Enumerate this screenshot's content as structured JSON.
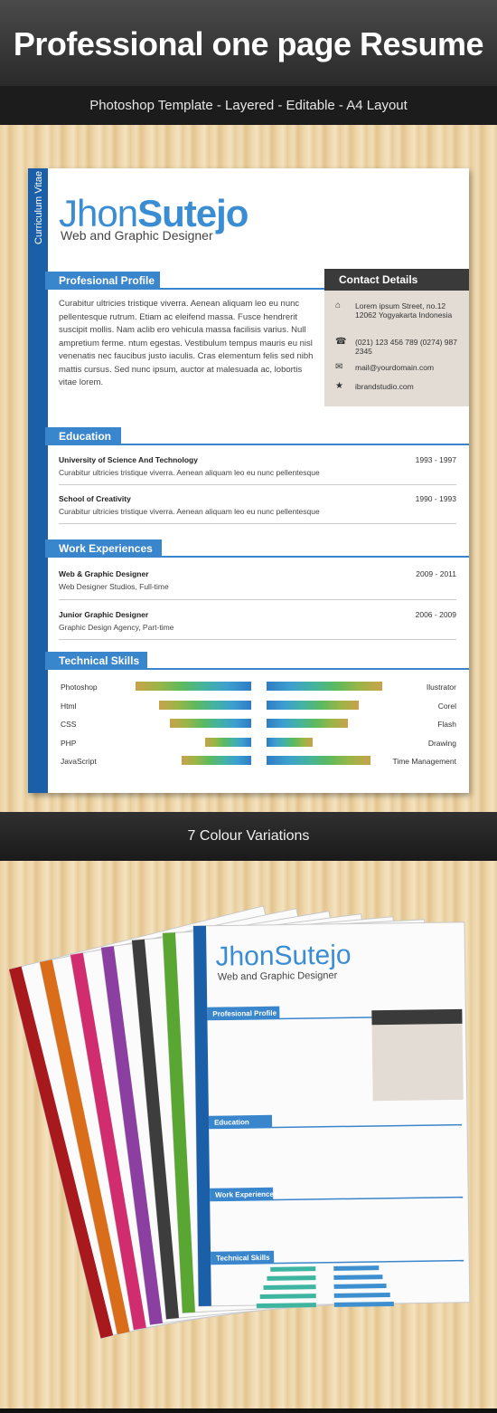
{
  "header": {
    "title": "Professional one page Resume",
    "subtitle": "Photoshop Template - Layered - Editable - A4 Layout"
  },
  "resume": {
    "side_label": "Curriculum Vitae",
    "first_name": "Jhon",
    "last_name": "Sutejo",
    "role": "Web and Graphic Designer",
    "profile_heading": "Profesional Profile",
    "profile_text": "Curabitur ultricies tristique viverra. Aenean aliquam leo eu nunc pellentesque rutrum. Etiam ac eleifend massa. Fusce hendrerit suscipit mollis. Nam aclib ero vehicula massa facilisis varius. Null ampretium ferme. ntum egestas. Vestibulum tempus mauris eu nisl venenatis nec faucibus justo iaculis. Cras elementum felis sed nibh mattis cursus. Sed nunc ipsum, auctor at malesuada ac, lobortis vitae lorem.",
    "contact": {
      "heading": "Contact Details",
      "items": [
        {
          "icon": "home-icon",
          "text": "Lorem ipsum Street, no.12 12062 Yogyakarta Indonesia"
        },
        {
          "icon": "phone-icon",
          "text": "(021) 123 456 789 (0274) 987 2345"
        },
        {
          "icon": "mail-icon",
          "text": "mail@yourdomain.com"
        },
        {
          "icon": "star-icon",
          "text": "ibrandstudio.com"
        }
      ]
    },
    "education_heading": "Education",
    "education": [
      {
        "title": "University of Science And Technology",
        "desc": "Curabitur ultricies tristique viverra. Aenean aliquam leo eu nunc pellentesque",
        "years": "1993 - 1997"
      },
      {
        "title": "School of Creativity",
        "desc": "Curabitur ultricies tristique viverra. Aenean aliquam leo eu nunc pellentesque",
        "years": "1990 - 1993"
      }
    ],
    "work_heading": "Work Experiences",
    "work": [
      {
        "title": "Web & Graphic Designer",
        "desc": "Web Designer Studios, Full-time",
        "years": "2009 - 2011"
      },
      {
        "title": "Junior Graphic Designer",
        "desc": "Graphic Design Agency, Part-time",
        "years": "2006 - 2009"
      }
    ],
    "skills_heading": "Technical Skills",
    "skills_left": [
      {
        "name": "Photoshop",
        "level": 1.0
      },
      {
        "name": "Html",
        "level": 0.8
      },
      {
        "name": "CSS",
        "level": 0.7
      },
      {
        "name": "PHP",
        "level": 0.4
      },
      {
        "name": "JavaScript",
        "level": 0.6
      }
    ],
    "skills_right": [
      {
        "name": "Ilustrator",
        "level": 1.0
      },
      {
        "name": "Corel",
        "level": 0.8
      },
      {
        "name": "Flash",
        "level": 0.7
      },
      {
        "name": "Drawing",
        "level": 0.4
      },
      {
        "name": "Time Management",
        "level": 0.9
      }
    ]
  },
  "variations_label": "7 Colour Variations",
  "variation_colors": [
    "#a8191d",
    "#d96d1a",
    "#d02c6e",
    "#8b3fa0",
    "#3d3d3d",
    "#5aa632",
    "#1b5fa8"
  ],
  "accent_color": "#3a86cc"
}
